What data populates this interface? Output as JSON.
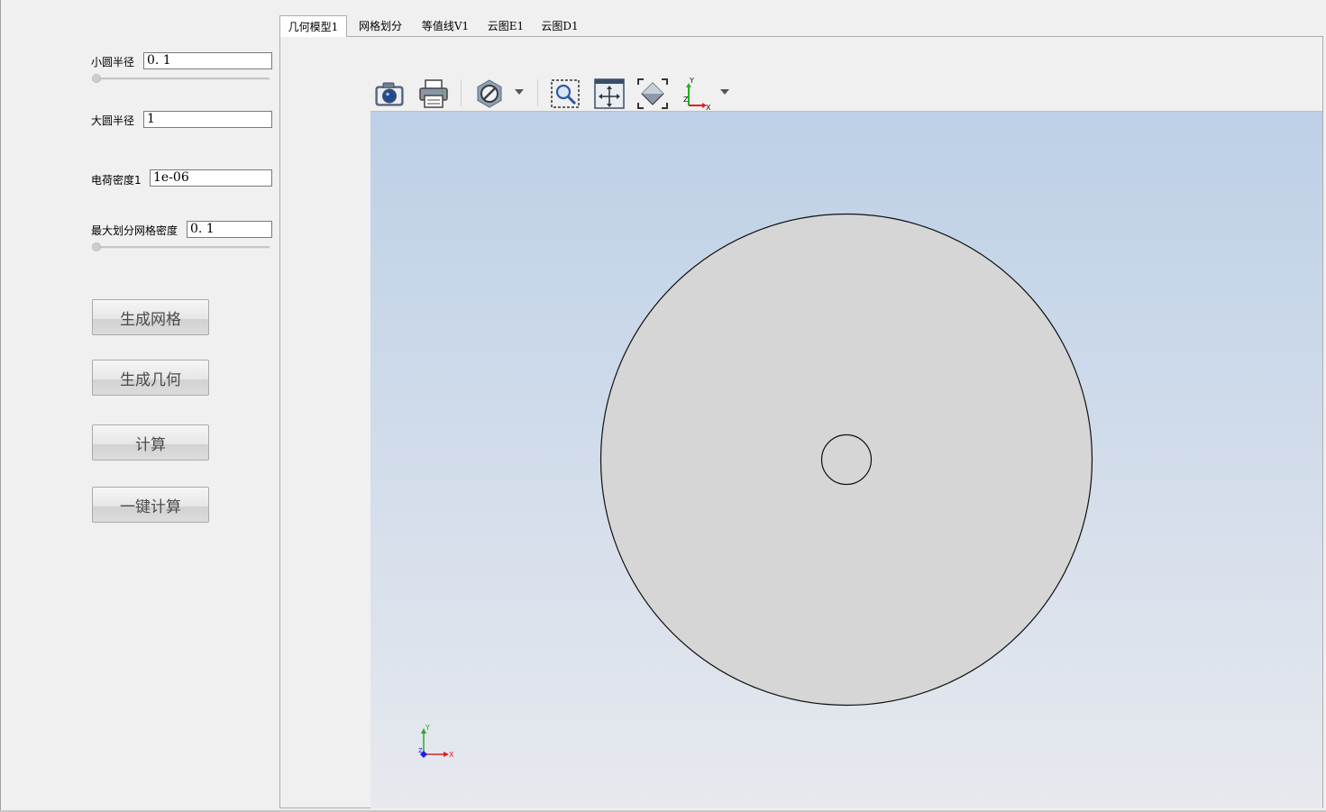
{
  "params": {
    "small_radius": {
      "label": "小圆半径",
      "value": "0. 1",
      "slider_value": 0
    },
    "large_radius": {
      "label": "大圆半径",
      "value": "1"
    },
    "charge_density": {
      "label": "电荷密度1",
      "value": "1e-06"
    },
    "mesh_density": {
      "label": "最大划分网格密度",
      "value": "0. 1",
      "slider_value": 0
    }
  },
  "buttons": {
    "generate_mesh": "生成网格",
    "generate_geometry": "生成几何",
    "compute": "计算",
    "one_click_compute": "一键计算"
  },
  "tabs": [
    {
      "label": "几何模型1",
      "active": true
    },
    {
      "label": "网格划分",
      "active": false
    },
    {
      "label": "等值线V1",
      "active": false
    },
    {
      "label": "云图E1",
      "active": false
    },
    {
      "label": "云图D1",
      "active": false
    }
  ],
  "toolbar": {
    "icons": [
      "camera-icon",
      "print-icon",
      "no-entry-icon",
      "zoom-window-icon",
      "pan-icon",
      "fit-all-icon",
      "axis-view-icon"
    ]
  },
  "axes": {
    "x": "X",
    "y": "Y",
    "z": "Z"
  },
  "colors": {
    "canvas_top": "#bdd0e7",
    "canvas_bottom": "#e7e9ee",
    "geometry_fill": "#d6d6d6",
    "axis_x": "#e02020",
    "axis_y": "#20b020",
    "axis_z": "#2020e0"
  }
}
